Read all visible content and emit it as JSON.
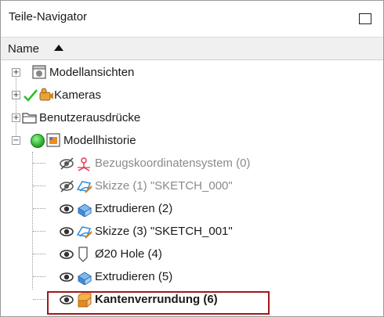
{
  "window": {
    "title": "Teile-Navigator"
  },
  "header": {
    "column_name": "Name"
  },
  "tree": {
    "modellansichten": "Modellansichten",
    "kameras": "Kameras",
    "benutzerausdruecke": "Benutzerausdrücke",
    "modellhistorie": "Modellhistorie",
    "features": [
      {
        "label": "Bezugskoordinatensystem (0)",
        "state": "suppressed"
      },
      {
        "label": "Skizze (1) \"SKETCH_000\"",
        "state": "suppressed"
      },
      {
        "label": "Extrudieren (2)",
        "state": "normal"
      },
      {
        "label": "Skizze (3) \"SKETCH_001\"",
        "state": "normal"
      },
      {
        "label": "Ø20 Hole (4)",
        "state": "normal"
      },
      {
        "label": "Extrudieren (5)",
        "state": "normal"
      },
      {
        "label": "Kantenverrundung (6)",
        "state": "current"
      }
    ]
  },
  "colors": {
    "highlight_border": "#a4161a",
    "check_green": "#2fbf2f",
    "status_green": "#22a322"
  },
  "icons": [
    "maximize-icon",
    "sort-up-icon",
    "model-views-icon",
    "check-icon",
    "camera-icon",
    "folder-icon",
    "status-green-icon",
    "history-icon",
    "eye-icon",
    "eye-hidden-icon",
    "coordinate-system-icon",
    "sketch-icon",
    "extrude-icon",
    "hole-icon",
    "edge-blend-icon"
  ]
}
